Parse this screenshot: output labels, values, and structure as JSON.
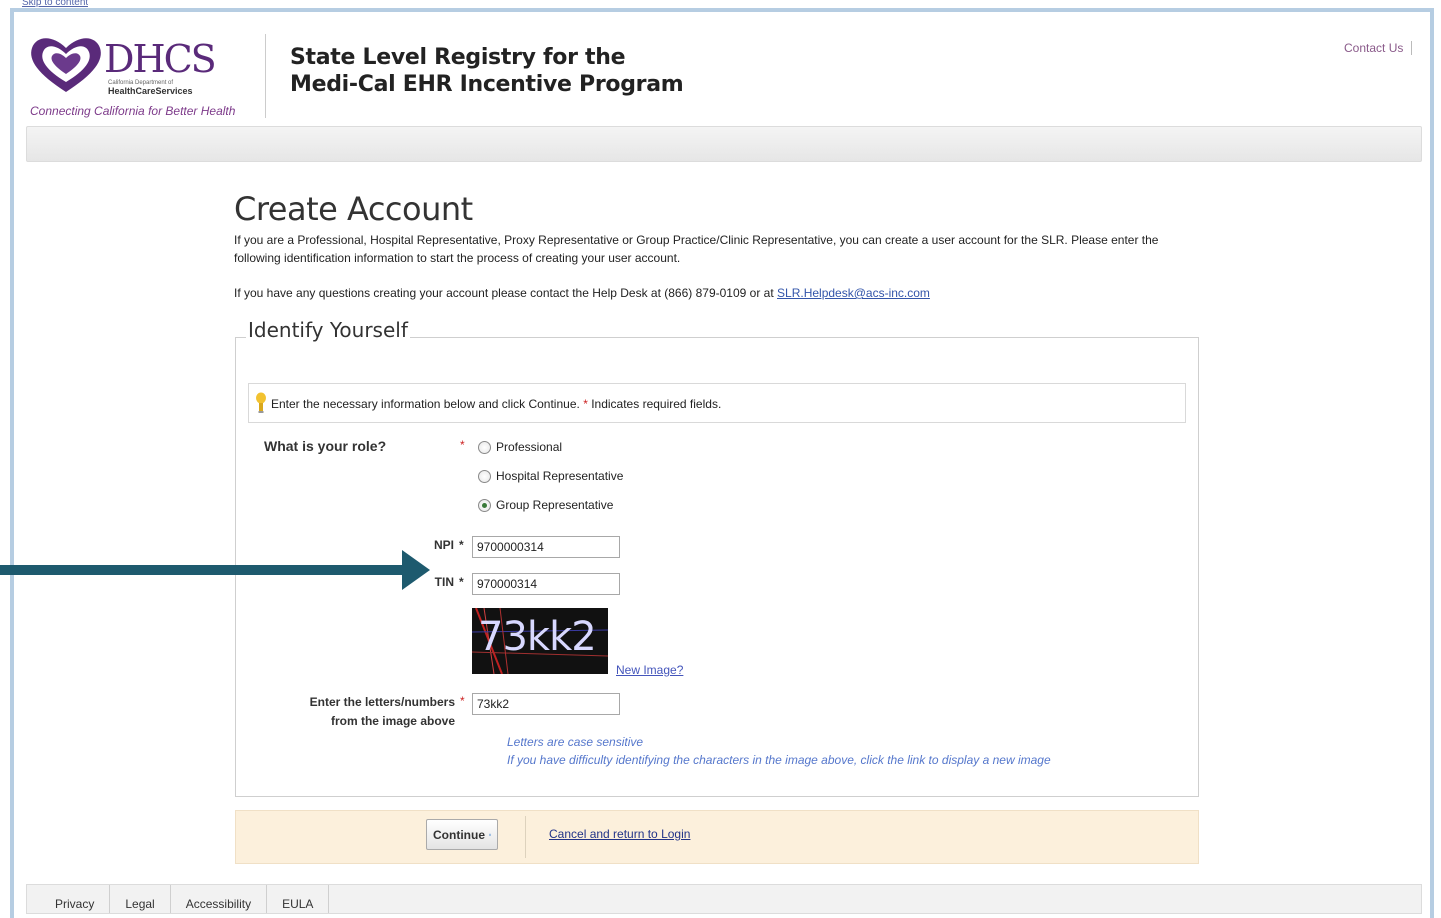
{
  "header": {
    "skip_link": "Skip to content",
    "logo_text": "DHCS",
    "logo_dept_line1": "California Department of",
    "logo_dept_line2": "HealthCareServices",
    "logo_tagline": "Connecting California for Better Health",
    "app_title_line1": "State Level Registry for the",
    "app_title_line2": "Medi-Cal EHR Incentive Program",
    "contact_link": "Contact Us"
  },
  "page": {
    "title": "Create Account",
    "intro": "If you are a Professional, Hospital Representative, Proxy Representative or Group Practice/Clinic Representative, you can create a user account for the SLR. Please enter the following identification information to start the process of creating your user account.",
    "help_text": "If you have any questions creating your account please contact the Help Desk at (866) 879-0109 or at",
    "help_email": "SLR.Helpdesk@acs-inc.com"
  },
  "form": {
    "legend": "Identify Yourself",
    "hint_text": "Enter the necessary information below and click Continue.",
    "required_marker": "*",
    "required_note": "Indicates required fields.",
    "role_label": "What is your role?",
    "roles": [
      {
        "label": "Professional",
        "checked": false
      },
      {
        "label": "Hospital Representative",
        "checked": false
      },
      {
        "label": "Group Representative",
        "checked": true
      }
    ],
    "npi_label": "NPI",
    "npi_value": "9700000314",
    "tin_label": "TIN",
    "tin_value": "970000314",
    "captcha_image_text": "73kk2",
    "new_image_link": "New Image?",
    "captcha_label_line1": "Enter the letters/numbers",
    "captcha_label_line2": "from the image above",
    "captcha_value": "73kk2",
    "note_case": "Letters are case sensitive",
    "note_difficulty": "If you have difficulty identifying the characters in the image above, click the link to display a new image"
  },
  "actions": {
    "continue_label": "Continue",
    "cancel_link": "Cancel and return to Login"
  },
  "footer": {
    "items": [
      "Privacy",
      "Legal",
      "Accessibility",
      "EULA"
    ]
  },
  "colors": {
    "arrow": "#1e5a6e",
    "frame": "#b6cde2",
    "button_bar": "#fcf0dc",
    "logo_purple": "#5a2a7a"
  }
}
